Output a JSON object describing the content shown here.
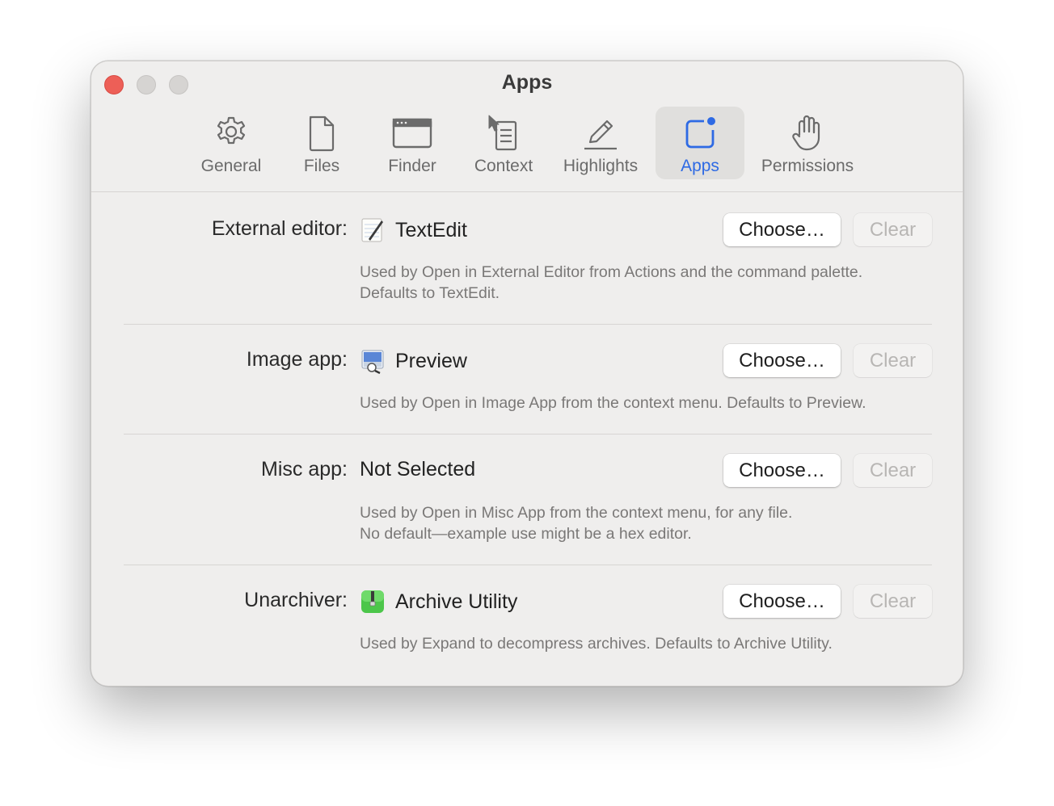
{
  "window": {
    "title": "Apps"
  },
  "tabs": [
    {
      "label": "General",
      "icon": "gear-icon"
    },
    {
      "label": "Files",
      "icon": "document-icon"
    },
    {
      "label": "Finder",
      "icon": "window-icon"
    },
    {
      "label": "Context",
      "icon": "context-menu-icon"
    },
    {
      "label": "Highlights",
      "icon": "pencil-icon"
    },
    {
      "label": "Apps",
      "icon": "app-badge-icon",
      "active": true
    },
    {
      "label": "Permissions",
      "icon": "hand-icon"
    }
  ],
  "accent_color": "#2e6ae4",
  "rows": [
    {
      "label": "External editor:",
      "value": "TextEdit",
      "icon": "textedit-icon",
      "choose": "Choose…",
      "clear": "Clear",
      "description": [
        "Used by Open in External Editor from Actions and the command palette.",
        "Defaults to TextEdit."
      ]
    },
    {
      "label": "Image app:",
      "value": "Preview",
      "icon": "preview-icon",
      "choose": "Choose…",
      "clear": "Clear",
      "description": [
        "Used by Open in Image App from the context menu. Defaults to Preview."
      ]
    },
    {
      "label": "Misc app:",
      "value": "Not Selected",
      "choose": "Choose…",
      "clear": "Clear",
      "description": [
        "Used by Open in Misc App from the context menu, for any file.",
        "No default—example use might be a hex editor."
      ]
    },
    {
      "label": "Unarchiver:",
      "value": "Archive Utility",
      "icon": "archive-utility-icon",
      "choose": "Choose…",
      "clear": "Clear",
      "description": [
        "Used by Expand to decompress archives. Defaults to Archive Utility."
      ]
    }
  ]
}
